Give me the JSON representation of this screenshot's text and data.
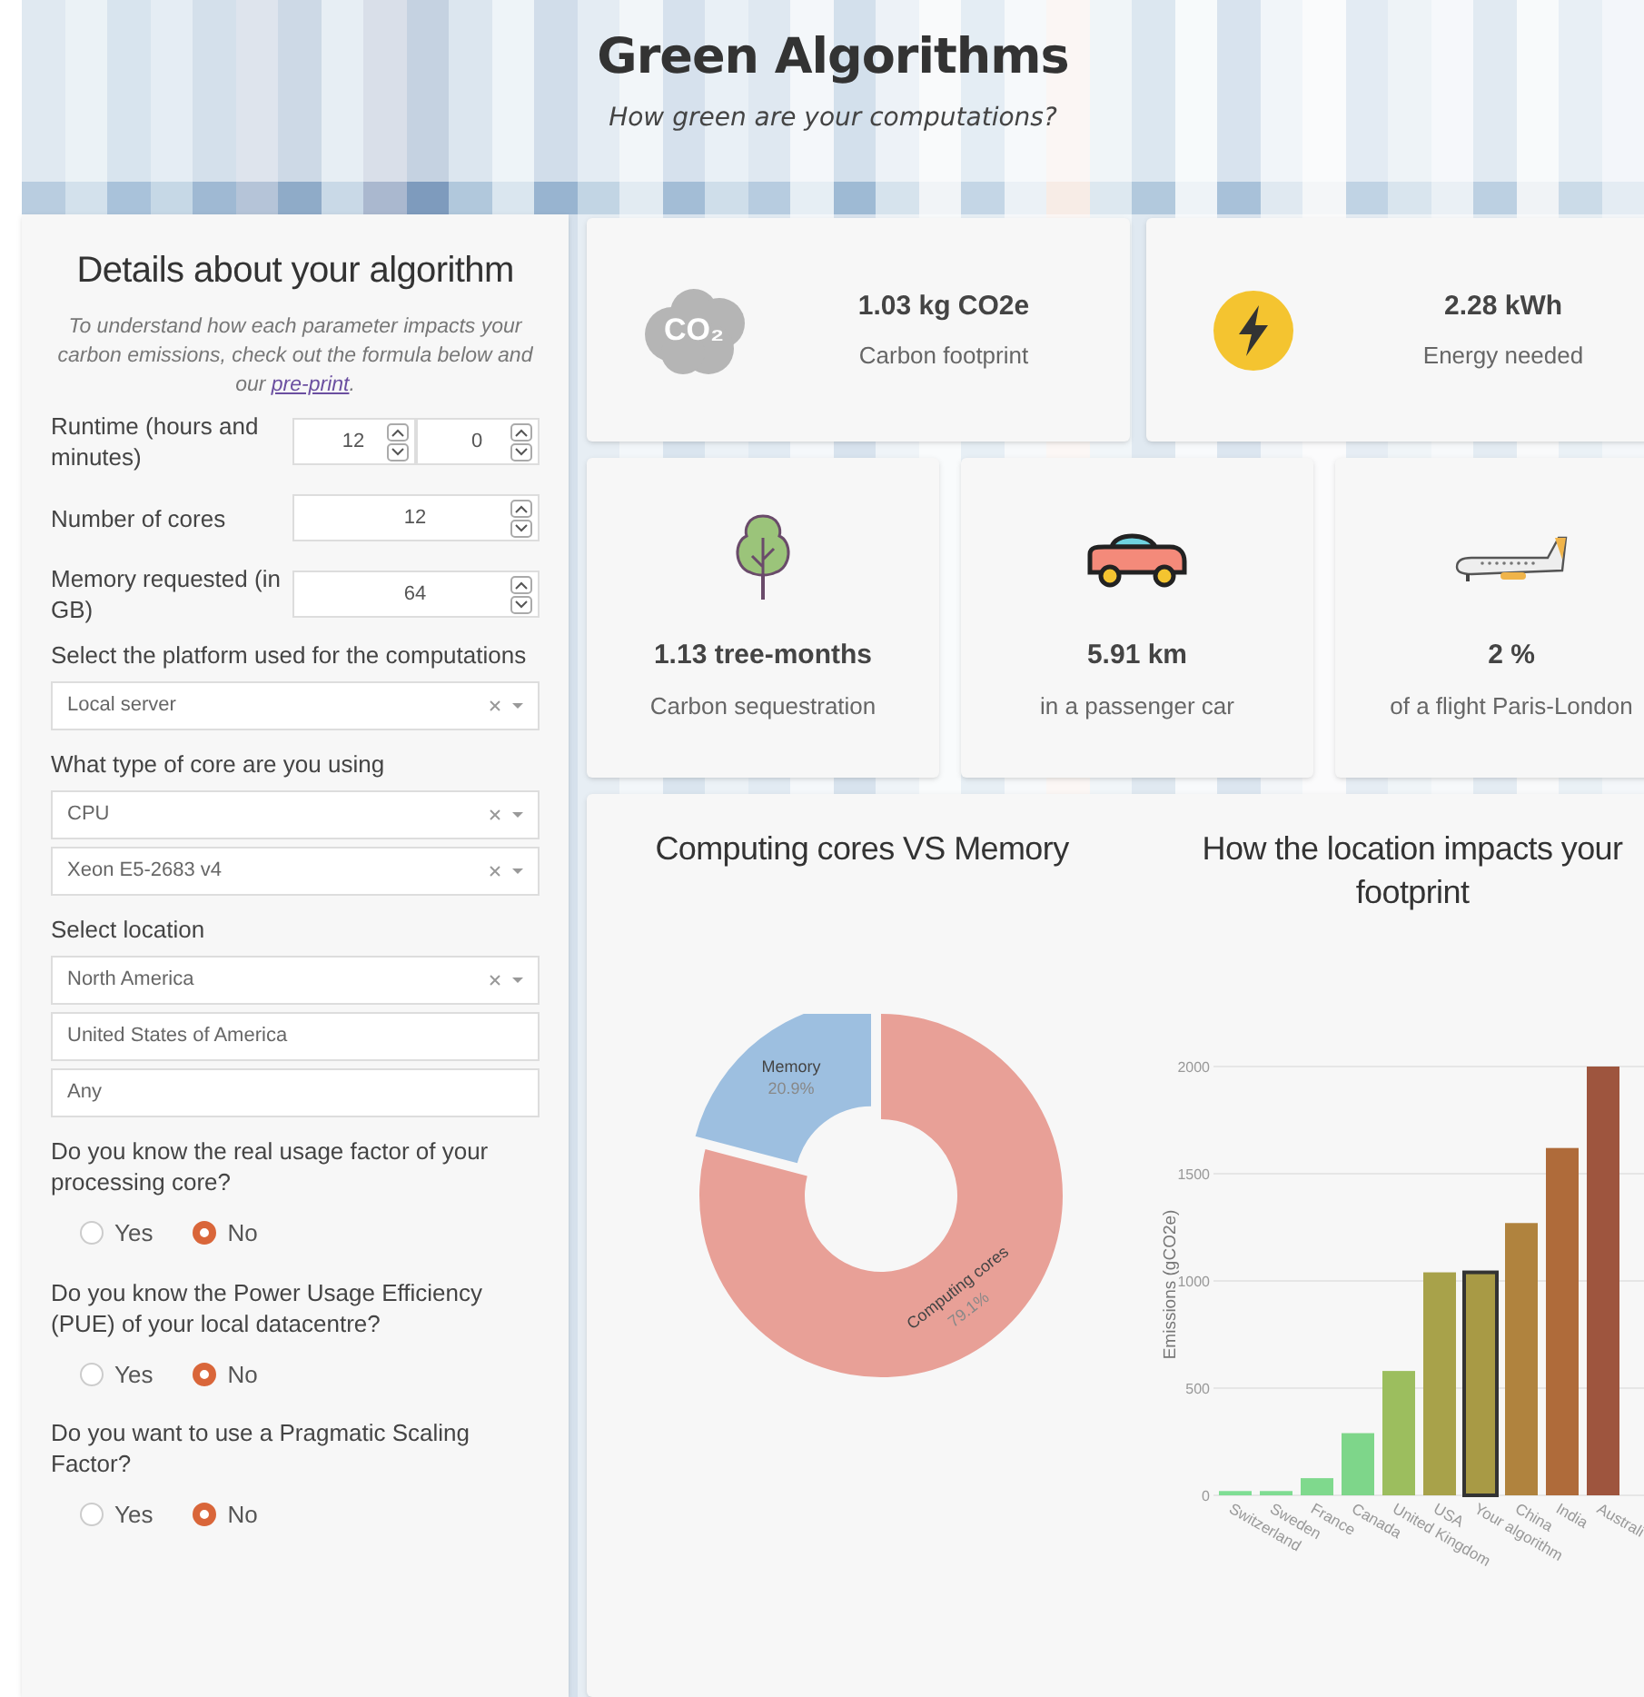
{
  "header": {
    "title": "Green Algorithms",
    "subtitle": "How green are your computations?"
  },
  "form": {
    "title": "Details about your algorithm",
    "intro": "To understand how each parameter impacts your carbon emissions, check out the formula below and our ",
    "intro_link": "pre-print",
    "intro_end": ".",
    "fields": [
      {
        "kind": "numbers",
        "label": "Runtime (hours and minutes)",
        "values": [
          "12",
          "0"
        ]
      },
      {
        "kind": "numbers",
        "label": "Number of cores",
        "values": [
          "12"
        ]
      },
      {
        "kind": "numbers",
        "label": "Memory requested (in GB)",
        "values": [
          "64"
        ]
      },
      {
        "kind": "select",
        "label": "Select the platform used for the computations",
        "selects": [
          {
            "value": "Local server",
            "clearable": true
          }
        ]
      },
      {
        "kind": "select",
        "label": "What type of core are you using",
        "selects": [
          {
            "value": "CPU",
            "clearable": true
          },
          {
            "value": "Xeon E5-2683 v4",
            "clearable": true
          }
        ]
      },
      {
        "kind": "select",
        "label": "Select location",
        "selects": [
          {
            "value": "North America",
            "clearable": true
          },
          {
            "value": "United States of America",
            "clearable": false
          },
          {
            "value": "Any",
            "clearable": false
          }
        ]
      },
      {
        "kind": "radio",
        "label": "Do you know the real usage factor of your processing core?",
        "options": [
          {
            "label": "Yes",
            "selected": false
          },
          {
            "label": "No",
            "selected": true
          }
        ]
      },
      {
        "kind": "radio",
        "label": "Do you know the Power Usage Efficiency (PUE) of your local datacentre?",
        "options": [
          {
            "label": "Yes",
            "selected": false
          },
          {
            "label": "No",
            "selected": true
          }
        ]
      },
      {
        "kind": "radio",
        "label": "Do you want to use a Pragmatic Scaling Factor?",
        "options": [
          {
            "label": "Yes",
            "selected": false
          },
          {
            "label": "No",
            "selected": true
          }
        ]
      }
    ]
  },
  "summary_cards": [
    {
      "kind": "co2",
      "icon_label": "CO₂",
      "value": "1.03 kg CO2e",
      "caption": "Carbon footprint"
    },
    {
      "kind": "energy",
      "value": "2.28 kWh",
      "caption": "Energy needed"
    }
  ],
  "equivalence_cards": [
    {
      "kind": "tree",
      "value": "1.13 tree-months",
      "caption": "Carbon sequestration"
    },
    {
      "kind": "car",
      "value": "5.91 km",
      "caption": "in a passenger car"
    },
    {
      "kind": "plane",
      "value": "2 %",
      "caption": "of a flight Paris-London"
    }
  ],
  "charts": [
    {
      "title": "Computing cores VS Memory",
      "chart_data": {
        "type": "donut",
        "categories": [
          "Computing cores",
          "Memory"
        ],
        "values": [
          79.1,
          20.9
        ],
        "value_labels": [
          "79.1%",
          "20.9%"
        ]
      }
    },
    {
      "title": "How the location impacts your footprint",
      "chart_data": {
        "type": "bar",
        "ylabel": "Emissions (gCO2e)",
        "categories": [
          "Switzerland",
          "Sweden",
          "France",
          "Canada",
          "United Kingdom",
          "USA",
          "Your algorithm",
          "China",
          "India",
          "Australi"
        ],
        "values": [
          20,
          20,
          80,
          290,
          580,
          1040,
          1040,
          1270,
          1620,
          2000
        ],
        "colors": [
          "#7fde94",
          "#7fdc92",
          "#7fd98d",
          "#7ed68a",
          "#9cbe5e",
          "#a8a24a",
          "#a89a45",
          "#b0833e",
          "#af6b3a",
          "#9e553e"
        ],
        "grid": true,
        "ylim": [
          0,
          2000
        ],
        "yticks": [
          0,
          500,
          1000,
          1500,
          2000
        ]
      },
      "bars": [
        {
          "outlined": false
        },
        {
          "outlined": false
        },
        {
          "outlined": false
        },
        {
          "outlined": false
        },
        {
          "outlined": false
        },
        {
          "outlined": false
        },
        {
          "outlined": true
        },
        {
          "outlined": false
        },
        {
          "outlined": false
        },
        {
          "outlined": false
        }
      ]
    }
  ]
}
